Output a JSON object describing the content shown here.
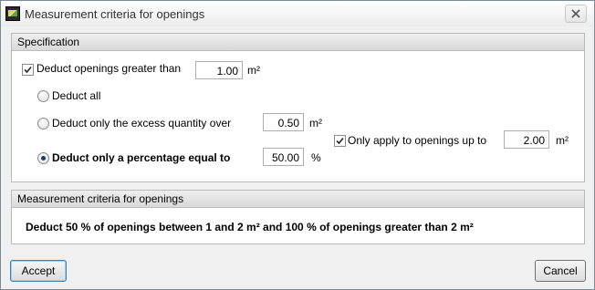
{
  "window": {
    "title": "Measurement criteria for openings",
    "icon": "app-icon",
    "close_icon": "close-icon"
  },
  "specification": {
    "header": "Specification",
    "deduct_greater": {
      "checked": true,
      "label": "Deduct openings greater than",
      "value": "1.00",
      "unit": "m²"
    },
    "options": {
      "deduct_all": {
        "label": "Deduct all",
        "selected": false
      },
      "excess": {
        "label": "Deduct only the excess quantity over",
        "value": "0.50",
        "unit": "m²",
        "selected": false
      },
      "percentage": {
        "label": "Deduct only a percentage equal to",
        "value": "50.00",
        "unit": "%",
        "selected": true
      }
    },
    "apply_up_to": {
      "checked": true,
      "label": "Only apply to openings up to",
      "value": "2.00",
      "unit": "m²"
    }
  },
  "summary": {
    "header": "Measurement criteria for openings",
    "text": "Deduct 50 % of openings between 1 and 2 m² and 100 % of openings greater than 2 m²"
  },
  "buttons": {
    "accept": "Accept",
    "cancel": "Cancel"
  }
}
